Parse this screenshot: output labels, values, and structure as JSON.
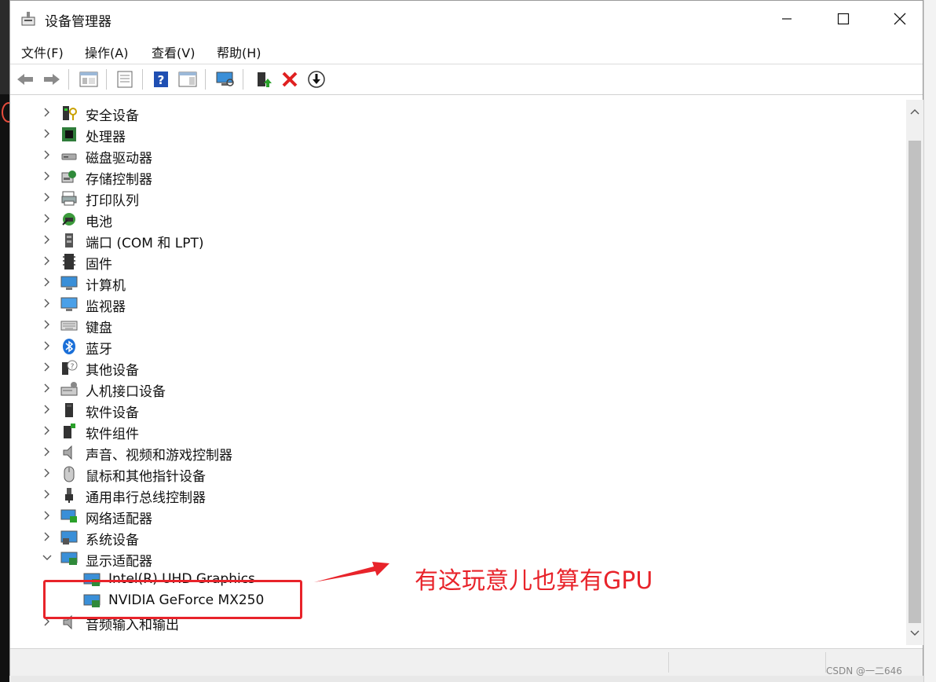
{
  "window": {
    "title": "设备管理器"
  },
  "menu": [
    "文件(F)",
    "操作(A)",
    "查看(V)",
    "帮助(H)"
  ],
  "toolbar": [
    {
      "icon": "back-arrow-icon"
    },
    {
      "icon": "forward-arrow-icon"
    },
    {
      "icon": "show-hide-console-tree-icon"
    },
    {
      "icon": "properties-icon"
    },
    {
      "icon": "help-icon"
    },
    {
      "icon": "action-pane-icon"
    },
    {
      "icon": "scan-hardware-icon"
    },
    {
      "icon": "update-driver-icon"
    },
    {
      "icon": "uninstall-device-icon"
    },
    {
      "icon": "disable-device-icon"
    }
  ],
  "tree": {
    "categories": [
      {
        "label": "安全设备",
        "icon": "security-device-icon",
        "expanded": false
      },
      {
        "label": "处理器",
        "icon": "processor-icon",
        "expanded": false
      },
      {
        "label": "磁盘驱动器",
        "icon": "disk-drive-icon",
        "expanded": false
      },
      {
        "label": "存储控制器",
        "icon": "storage-controller-icon",
        "expanded": false
      },
      {
        "label": "打印队列",
        "icon": "print-queue-icon",
        "expanded": false
      },
      {
        "label": "电池",
        "icon": "battery-icon",
        "expanded": false
      },
      {
        "label": "端口 (COM 和 LPT)",
        "icon": "port-icon",
        "expanded": false
      },
      {
        "label": "固件",
        "icon": "firmware-icon",
        "expanded": false
      },
      {
        "label": "计算机",
        "icon": "computer-icon",
        "expanded": false
      },
      {
        "label": "监视器",
        "icon": "monitor-icon",
        "expanded": false
      },
      {
        "label": "键盘",
        "icon": "keyboard-icon",
        "expanded": false
      },
      {
        "label": "蓝牙",
        "icon": "bluetooth-icon",
        "expanded": false
      },
      {
        "label": "其他设备",
        "icon": "other-device-icon",
        "expanded": false
      },
      {
        "label": "人机接口设备",
        "icon": "hid-icon",
        "expanded": false
      },
      {
        "label": "软件设备",
        "icon": "software-device-icon",
        "expanded": false
      },
      {
        "label": "软件组件",
        "icon": "software-component-icon",
        "expanded": false
      },
      {
        "label": "声音、视频和游戏控制器",
        "icon": "sound-icon",
        "expanded": false
      },
      {
        "label": "鼠标和其他指针设备",
        "icon": "mouse-icon",
        "expanded": false
      },
      {
        "label": "通用串行总线控制器",
        "icon": "usb-icon",
        "expanded": false
      },
      {
        "label": "网络适配器",
        "icon": "network-adapter-icon",
        "expanded": false
      },
      {
        "label": "系统设备",
        "icon": "system-device-icon",
        "expanded": false
      },
      {
        "label": "显示适配器",
        "icon": "display-adapter-icon",
        "expanded": true,
        "children": [
          "Intel(R) UHD Graphics",
          "NVIDIA GeForce MX250"
        ]
      },
      {
        "label": "音频输入和输出",
        "icon": "audio-io-icon",
        "expanded": false
      }
    ]
  },
  "annotation": {
    "text": "有这玩意儿也算有GPU",
    "color": "#e8232a"
  },
  "watermark": "CSDN @一二646",
  "colors": {
    "accent_red": "#e8232a",
    "monitor_blue": "#3a8fd8"
  }
}
